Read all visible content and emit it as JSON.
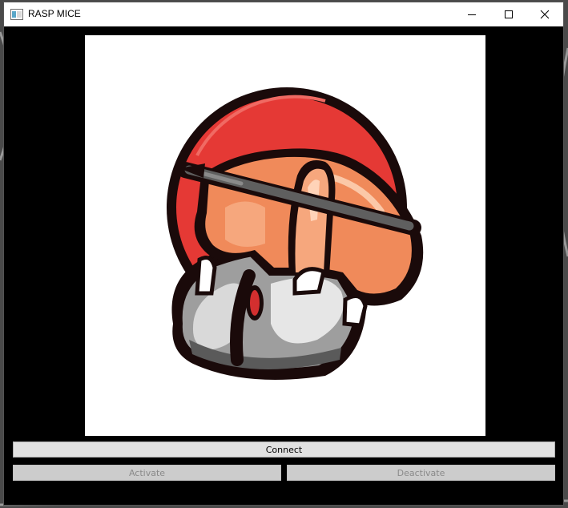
{
  "window": {
    "title": "RASP MICE",
    "controls": [
      "minimize-icon",
      "maximize-icon",
      "close-icon"
    ]
  },
  "logo": {
    "icon": "hand-on-mouse-with-pen-logo",
    "colors": {
      "circle": "#e53935",
      "outline": "#1a0a0a",
      "skin": "#f08a5a",
      "mouse": "#9e9e9e",
      "scroll_wheel": "#d32f2f"
    }
  },
  "buttons": {
    "connect": {
      "label": "Connect",
      "enabled": true
    },
    "activate": {
      "label": "Activate",
      "enabled": false
    },
    "deactivate": {
      "label": "Deactivate",
      "enabled": false
    }
  }
}
